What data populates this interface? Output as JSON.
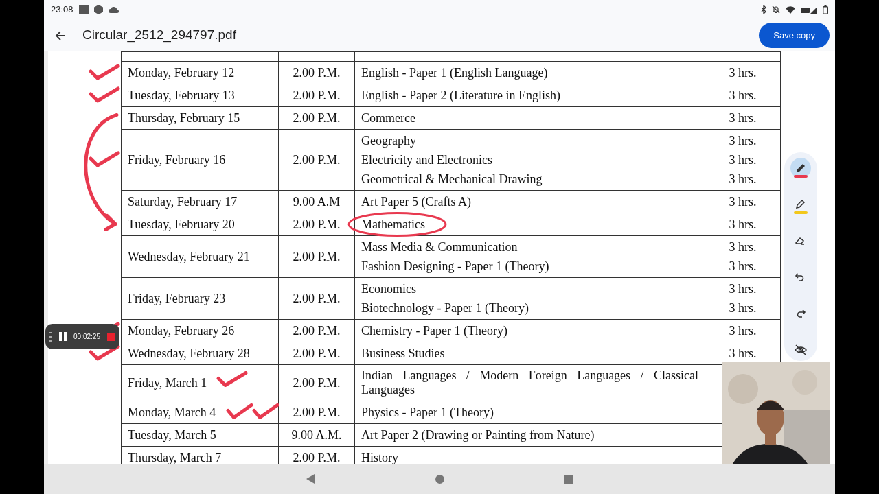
{
  "status_bar": {
    "time": "23:08"
  },
  "app_bar": {
    "title": "Circular_2512_294797.pdf",
    "action": "Save copy"
  },
  "schedule": {
    "rows": [
      {
        "date": "Monday, February 12",
        "time": "2.00 P.M.",
        "subjects": [
          {
            "name": "English - Paper 1 (English Language)",
            "duration": "3 hrs."
          }
        ]
      },
      {
        "date": "Tuesday, February 13",
        "time": "2.00 P.M.",
        "subjects": [
          {
            "name": "English - Paper 2 (Literature in English)",
            "duration": "3 hrs."
          }
        ]
      },
      {
        "date": "Thursday, February 15",
        "time": "2.00 P.M.",
        "subjects": [
          {
            "name": "Commerce",
            "duration": "3 hrs."
          }
        ]
      },
      {
        "date": "Friday, February 16",
        "time": "2.00 P.M.",
        "subjects": [
          {
            "name": "Geography",
            "duration": "3 hrs."
          },
          {
            "name": "Electricity and Electronics",
            "duration": "3 hrs."
          },
          {
            "name": "Geometrical & Mechanical Drawing",
            "duration": "3 hrs."
          }
        ]
      },
      {
        "date": "Saturday, February 17",
        "time": "9.00 A.M",
        "subjects": [
          {
            "name": "Art Paper 5 (Crafts A)",
            "duration": "3 hrs."
          }
        ]
      },
      {
        "date": "Tuesday, February 20",
        "time": "2.00 P.M.",
        "subjects": [
          {
            "name": "Mathematics",
            "duration": "3 hrs.",
            "circled": true
          }
        ]
      },
      {
        "date": "Wednesday, February 21",
        "time": "2.00 P.M.",
        "subjects": [
          {
            "name": "Mass Media & Communication",
            "duration": "3 hrs."
          },
          {
            "name": "Fashion Designing - Paper 1 (Theory)",
            "duration": "3 hrs."
          }
        ]
      },
      {
        "date": "Friday, February 23",
        "time": "2.00 P.M.",
        "subjects": [
          {
            "name": "Economics",
            "duration": "3 hrs."
          },
          {
            "name": "Biotechnology - Paper 1 (Theory)",
            "duration": "3 hrs."
          }
        ]
      },
      {
        "date": "Monday, February 26",
        "time": "2.00 P.M.",
        "subjects": [
          {
            "name": "Chemistry - Paper 1 (Theory)",
            "duration": "3 hrs."
          }
        ]
      },
      {
        "date": "Wednesday, February 28",
        "time": "2.00 P.M.",
        "subjects": [
          {
            "name": "Business Studies",
            "duration": "3 hrs."
          }
        ]
      },
      {
        "date": "Friday, March 1",
        "time": "2.00 P.M.",
        "subjects": [
          {
            "name": "Indian Languages / Modern Foreign Languages / Classical Languages"
          }
        ]
      },
      {
        "date": "Monday, March 4",
        "time": "2.00 P.M.",
        "subjects": [
          {
            "name": "Physics - Paper 1 (Theory)"
          }
        ]
      },
      {
        "date": "Tuesday, March 5",
        "time": "9.00 A.M.",
        "subjects": [
          {
            "name": "Art Paper 2 (Drawing or Painting from Nature)"
          }
        ]
      },
      {
        "date": "Thursday, March 7",
        "time": "2.00 P.M.",
        "subjects": [
          {
            "name": "History"
          }
        ]
      }
    ]
  },
  "annotation_tools": [
    {
      "kind": "pen",
      "selected": true,
      "color": "#e8394f"
    },
    {
      "kind": "highlighter",
      "selected": false,
      "color": "#f2c81c"
    },
    {
      "kind": "eraser",
      "selected": false
    },
    {
      "kind": "undo",
      "selected": false
    },
    {
      "kind": "redo",
      "selected": false
    },
    {
      "kind": "hide",
      "selected": false
    }
  ],
  "recorder": {
    "elapsed": "00:02:25"
  }
}
